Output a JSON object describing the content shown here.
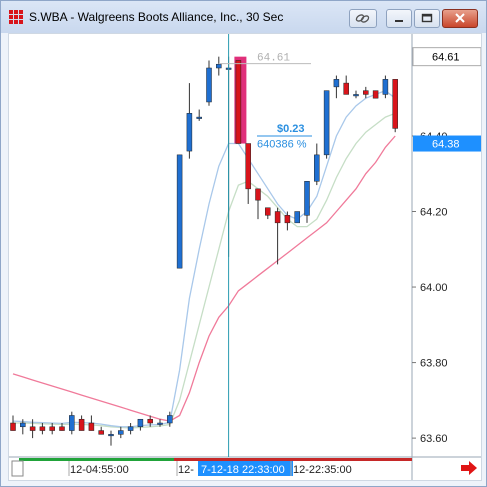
{
  "window": {
    "title": "S.WBA - Walgreens Boots Alliance, Inc., 30 Sec"
  },
  "titlebar_buttons": [
    {
      "name": "link-button",
      "icon": "link-icon"
    },
    {
      "name": "minimize-button",
      "icon": "minimize-icon"
    },
    {
      "name": "maximize-button",
      "icon": "maximize-icon"
    },
    {
      "name": "close-button",
      "icon": "close-icon"
    }
  ],
  "price_axis": {
    "ticks": [
      "64.40",
      "64.20",
      "64.00",
      "63.80",
      "63.60"
    ],
    "high_label": "64.61",
    "current_label": "64.38",
    "current_color": "#1e90ff"
  },
  "time_axis": {
    "labels": [
      "12-04:55:00",
      "12-",
      "7-12-18 22:33:00",
      "12-22:35:00"
    ]
  },
  "annotation": {
    "high_marker": "64.61",
    "change_value": "$0.23",
    "change_percent": "640386 %"
  },
  "colors": {
    "up_candle": "#1f6fd1",
    "down_candle": "#d8141b",
    "highlight_bar": "#e0307a",
    "ma_fast": "#a9c8ea",
    "ma_mid": "#c6dec6",
    "ma_slow": "#f07a9a",
    "crosshair": "#2a9bb0",
    "session_bar": "#21a33a"
  },
  "chart_data": {
    "type": "candlestick",
    "title": "S.WBA - Walgreens Boots Alliance, Inc., 30 Sec",
    "ylim": [
      63.55,
      64.67
    ],
    "candles": [
      {
        "o": 63.64,
        "h": 63.66,
        "l": 63.62,
        "c": 63.62
      },
      {
        "o": 63.63,
        "h": 63.65,
        "l": 63.61,
        "c": 63.64
      },
      {
        "o": 63.63,
        "h": 63.65,
        "l": 63.6,
        "c": 63.62
      },
      {
        "o": 63.63,
        "h": 63.64,
        "l": 63.61,
        "c": 63.62
      },
      {
        "o": 63.63,
        "h": 63.64,
        "l": 63.61,
        "c": 63.62
      },
      {
        "o": 63.63,
        "h": 63.64,
        "l": 63.62,
        "c": 63.62
      },
      {
        "o": 63.62,
        "h": 63.67,
        "l": 63.61,
        "c": 63.66
      },
      {
        "o": 63.65,
        "h": 63.66,
        "l": 63.62,
        "c": 63.62
      },
      {
        "o": 63.64,
        "h": 63.66,
        "l": 63.62,
        "c": 63.62
      },
      {
        "o": 63.62,
        "h": 63.63,
        "l": 63.61,
        "c": 63.61
      },
      {
        "o": 63.61,
        "h": 63.62,
        "l": 63.58,
        "c": 63.61
      },
      {
        "o": 63.61,
        "h": 63.63,
        "l": 63.6,
        "c": 63.62
      },
      {
        "o": 63.62,
        "h": 63.64,
        "l": 63.61,
        "c": 63.63
      },
      {
        "o": 63.63,
        "h": 63.65,
        "l": 63.62,
        "c": 63.65
      },
      {
        "o": 63.65,
        "h": 63.66,
        "l": 63.63,
        "c": 63.64
      },
      {
        "o": 63.64,
        "h": 63.65,
        "l": 63.63,
        "c": 63.64
      },
      {
        "o": 63.64,
        "h": 63.67,
        "l": 63.63,
        "c": 63.66
      },
      {
        "o": 64.05,
        "h": 64.35,
        "l": 64.05,
        "c": 64.35
      },
      {
        "o": 64.36,
        "h": 64.54,
        "l": 64.34,
        "c": 64.46
      },
      {
        "o": 64.45,
        "h": 64.47,
        "l": 64.44,
        "c": 64.45
      },
      {
        "o": 64.49,
        "h": 64.6,
        "l": 64.48,
        "c": 64.58
      },
      {
        "o": 64.58,
        "h": 64.61,
        "l": 64.56,
        "c": 64.59
      },
      {
        "o": 64.58,
        "h": 64.61,
        "l": 64.08,
        "c": 64.58
      },
      {
        "o": 64.6,
        "h": 64.6,
        "l": 64.38,
        "c": 64.38
      },
      {
        "o": 64.38,
        "h": 64.38,
        "l": 64.22,
        "c": 64.26
      },
      {
        "o": 64.26,
        "h": 64.26,
        "l": 64.18,
        "c": 64.23
      },
      {
        "o": 64.21,
        "h": 64.21,
        "l": 64.18,
        "c": 64.19
      },
      {
        "o": 64.2,
        "h": 64.21,
        "l": 64.06,
        "c": 64.17
      },
      {
        "o": 64.19,
        "h": 64.2,
        "l": 64.15,
        "c": 64.17
      },
      {
        "o": 64.17,
        "h": 64.2,
        "l": 64.17,
        "c": 64.2
      },
      {
        "o": 64.19,
        "h": 64.28,
        "l": 64.17,
        "c": 64.28
      },
      {
        "o": 64.28,
        "h": 64.38,
        "l": 64.27,
        "c": 64.35
      },
      {
        "o": 64.35,
        "h": 64.52,
        "l": 64.34,
        "c": 64.52
      },
      {
        "o": 64.53,
        "h": 64.56,
        "l": 64.5,
        "c": 64.55
      },
      {
        "o": 64.54,
        "h": 64.56,
        "l": 64.51,
        "c": 64.51
      },
      {
        "o": 64.51,
        "h": 64.52,
        "l": 64.5,
        "c": 64.51
      },
      {
        "o": 64.52,
        "h": 64.53,
        "l": 64.5,
        "c": 64.51
      },
      {
        "o": 64.52,
        "h": 64.52,
        "l": 64.5,
        "c": 64.5
      },
      {
        "o": 64.51,
        "h": 64.56,
        "l": 64.5,
        "c": 64.55
      },
      {
        "o": 64.55,
        "h": 64.55,
        "l": 64.41,
        "c": 64.42
      }
    ],
    "ma_fast": [
      63.645,
      63.644,
      63.642,
      63.641,
      63.64,
      63.639,
      63.642,
      63.641,
      63.64,
      63.637,
      63.633,
      63.63,
      63.63,
      63.633,
      63.635,
      63.636,
      63.642,
      63.78,
      63.97,
      64.1,
      64.22,
      64.32,
      64.38,
      64.38,
      64.34,
      64.3,
      64.26,
      64.22,
      64.19,
      64.18,
      64.2,
      64.24,
      64.32,
      64.4,
      64.45,
      64.48,
      64.5,
      64.51,
      64.52,
      64.5
    ],
    "ma_mid": [
      63.64,
      63.64,
      63.639,
      63.638,
      63.637,
      63.636,
      63.637,
      63.636,
      63.635,
      63.633,
      63.63,
      63.628,
      63.627,
      63.628,
      63.63,
      63.632,
      63.636,
      63.7,
      63.8,
      63.9,
      64.0,
      64.1,
      64.2,
      64.27,
      64.28,
      64.26,
      64.24,
      64.21,
      64.18,
      64.16,
      64.16,
      64.18,
      64.23,
      64.29,
      64.34,
      64.38,
      64.41,
      64.43,
      64.45,
      64.46
    ],
    "ma_slow": [
      63.77,
      63.762,
      63.754,
      63.746,
      63.738,
      63.73,
      63.722,
      63.714,
      63.706,
      63.698,
      63.69,
      63.682,
      63.674,
      63.666,
      63.658,
      63.65,
      63.645,
      63.66,
      63.72,
      63.8,
      63.87,
      63.92,
      63.95,
      63.99,
      64.01,
      64.03,
      64.05,
      64.07,
      64.09,
      64.11,
      64.13,
      64.15,
      64.17,
      64.2,
      64.23,
      64.26,
      64.3,
      64.33,
      64.37,
      64.4
    ]
  }
}
